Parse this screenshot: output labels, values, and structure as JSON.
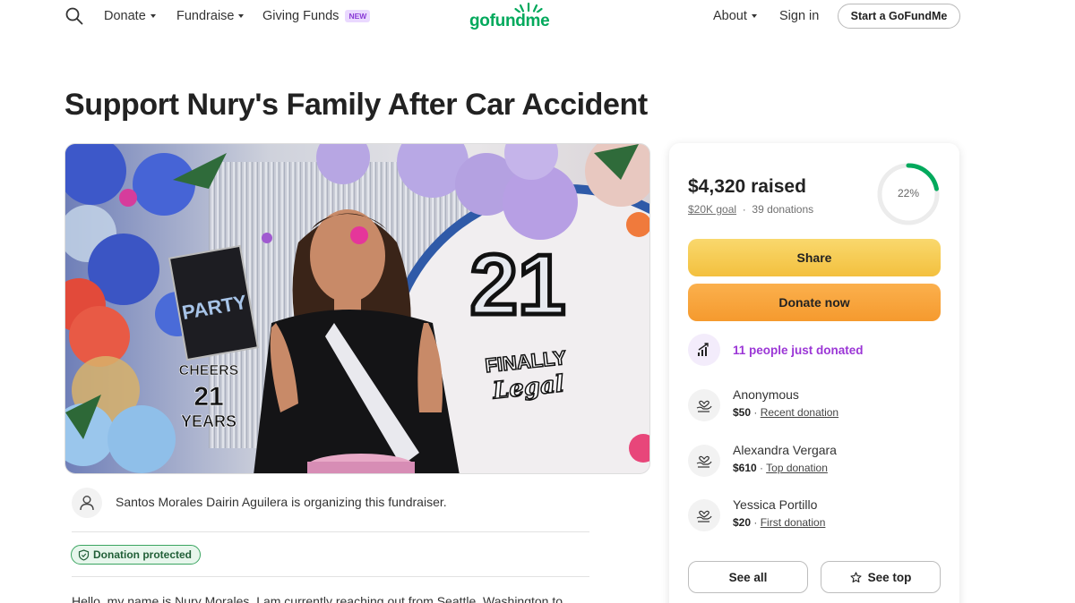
{
  "header": {
    "nav_left": [
      {
        "label": "Donate",
        "has_caret": true
      },
      {
        "label": "Fundraise",
        "has_caret": true
      },
      {
        "label": "Giving Funds",
        "badge": "NEW"
      }
    ],
    "logo_text": "gofundme",
    "nav_right": [
      {
        "label": "About",
        "has_caret": true
      },
      {
        "label": "Sign in"
      }
    ],
    "cta": "Start a GoFundMe"
  },
  "campaign": {
    "title": "Support Nury's Family After Car Accident",
    "organizer_text": "Santos Morales Dairin Aguilera is organizing this fundraiser.",
    "protected_label": "Donation protected",
    "story_preview": "Hello, my name is Nury Morales. I am currently reaching out from Seattle, Washington to"
  },
  "hero_decor": {
    "sign_party": "PARTY",
    "sign_cheers_1": "CHEERS",
    "sign_cheers_2": "21",
    "sign_cheers_3": "YEARS",
    "sign_21": "21",
    "sign_finally": "FINALLY",
    "sign_legal": "Legal"
  },
  "donation": {
    "raised": "$4,320 raised",
    "goal": "$20K goal",
    "donations": "39 donations",
    "percent": "22%",
    "progress": 0.22,
    "share_label": "Share",
    "donate_label": "Donate now",
    "trend_text": "11 people just donated",
    "donors": [
      {
        "name": "Anonymous",
        "amount": "$50",
        "tag": "Recent donation"
      },
      {
        "name": "Alexandra Vergara",
        "amount": "$610",
        "tag": "Top donation"
      },
      {
        "name": "Yessica Portillo",
        "amount": "$20",
        "tag": "First donation"
      }
    ],
    "see_all": "See all",
    "see_top": "See top"
  },
  "colors": {
    "brand_green": "#02a95c",
    "accent_purple": "#9b36d6",
    "share_yellow": "#f3c03e",
    "donate_orange": "#f59a2e"
  }
}
